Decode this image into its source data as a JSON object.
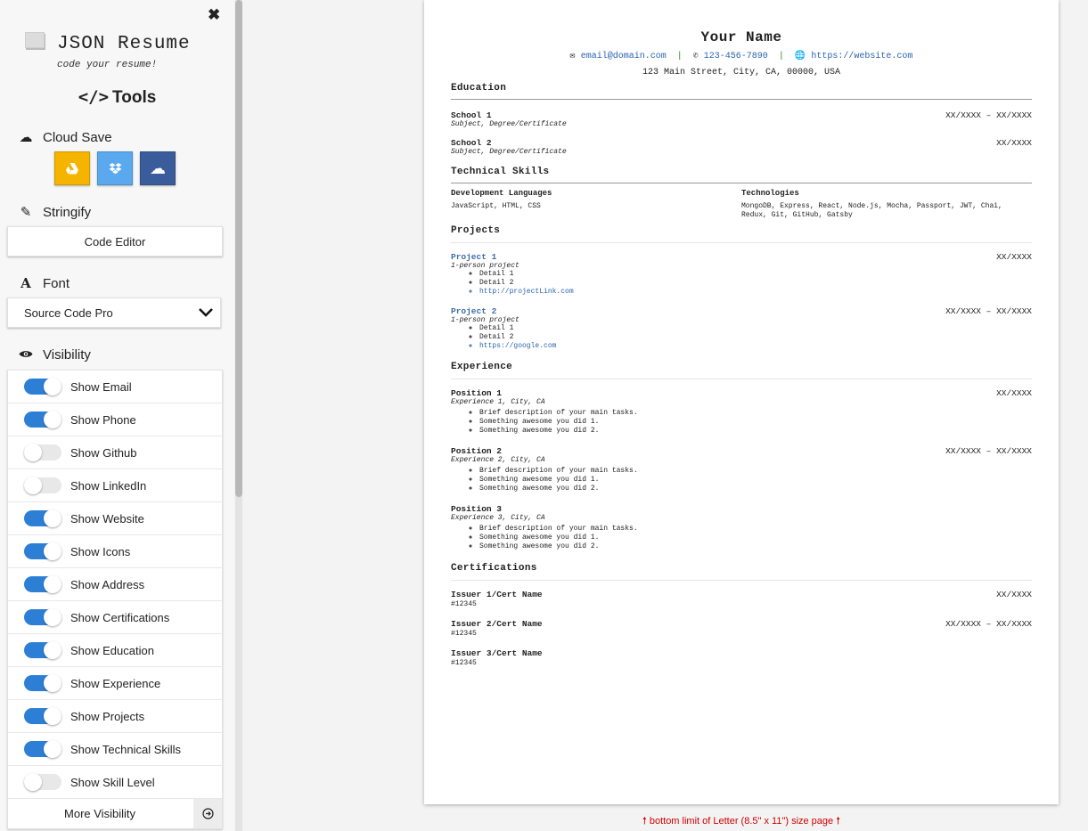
{
  "sidebar": {
    "close_icon": "✖",
    "logo": {
      "title": "JSON Resume",
      "subtitle": "code your resume!"
    },
    "tools_label": "Tools",
    "cloud_save": {
      "label": "Cloud Save",
      "buttons": [
        {
          "name": "google-drive",
          "color": "#f4b400"
        },
        {
          "name": "dropbox",
          "color": "#5aa8ee"
        },
        {
          "name": "cloud",
          "color": "#3a5c9a"
        }
      ]
    },
    "stringify": {
      "label": "Stringify",
      "button": "Code Editor"
    },
    "font": {
      "label": "Font",
      "selected": "Source Code Pro"
    },
    "visibility": {
      "label": "Visibility",
      "toggles": [
        {
          "label": "Show Email",
          "on": true
        },
        {
          "label": "Show Phone",
          "on": true
        },
        {
          "label": "Show Github",
          "on": false
        },
        {
          "label": "Show LinkedIn",
          "on": false
        },
        {
          "label": "Show Website",
          "on": true
        },
        {
          "label": "Show Icons",
          "on": true
        },
        {
          "label": "Show Address",
          "on": true
        },
        {
          "label": "Show Certifications",
          "on": true
        },
        {
          "label": "Show Education",
          "on": true
        },
        {
          "label": "Show Experience",
          "on": true
        },
        {
          "label": "Show Projects",
          "on": true
        },
        {
          "label": "Show Technical Skills",
          "on": true
        },
        {
          "label": "Show Skill Level",
          "on": false
        }
      ],
      "more": "More Visibility"
    }
  },
  "resume": {
    "name": "Your Name",
    "email": "email@domain.com",
    "phone": "123-456-7890",
    "website": "https://website.com",
    "address": "123 Main Street, City, CA, 00000, USA",
    "education": {
      "title": "Education",
      "items": [
        {
          "school": "School 1",
          "degree": "Subject, Degree/Certificate",
          "date": "XX/XXXX – XX/XXXX"
        },
        {
          "school": "School 2",
          "degree": "Subject, Degree/Certificate",
          "date": "XX/XXXX"
        }
      ]
    },
    "skills": {
      "title": "Technical Skills",
      "columns": [
        {
          "heading": "Development Languages",
          "text": "JavaScript, HTML, CSS"
        },
        {
          "heading": "Technologies",
          "text": "MongoDB, Express, React, Node.js, Mocha, Passport, JWT, Chai, Redux, Git, GitHub, Gatsby"
        }
      ]
    },
    "projects": {
      "title": "Projects",
      "items": [
        {
          "name": "Project 1",
          "sub": "1-person project",
          "date": "XX/XXXX",
          "details": [
            "Detail 1",
            "Detail 2"
          ],
          "link": "http://projectLink.com"
        },
        {
          "name": "Project 2",
          "sub": "1-person project",
          "date": "XX/XXXX – XX/XXXX",
          "details": [
            "Detail 1",
            "Detail 2"
          ],
          "link": "https://google.com"
        }
      ]
    },
    "experience": {
      "title": "Experience",
      "items": [
        {
          "position": "Position 1",
          "company": "Experience 1, City, CA",
          "date": "XX/XXXX",
          "bullets": [
            "Brief description of your main tasks.",
            "Something awesome you did 1.",
            "Something awesome you did 2."
          ]
        },
        {
          "position": "Position 2",
          "company": "Experience 2, City, CA",
          "date": "XX/XXXX – XX/XXXX",
          "bullets": [
            "Brief description of your main tasks.",
            "Something awesome you did 1.",
            "Something awesome you did 2."
          ]
        },
        {
          "position": "Position 3",
          "company": "Experience 3, City, CA",
          "date": "",
          "bullets": [
            "Brief description of your main tasks.",
            "Something awesome you did 1.",
            "Something awesome you did 2."
          ]
        }
      ]
    },
    "certifications": {
      "title": "Certifications",
      "items": [
        {
          "name": "Issuer 1/Cert Name",
          "id": "#12345",
          "date": "XX/XXXX"
        },
        {
          "name": "Issuer 2/Cert Name",
          "id": "#12345",
          "date": "XX/XXXX – XX/XXXX"
        },
        {
          "name": "Issuer 3/Cert Name",
          "id": "#12345",
          "date": ""
        }
      ]
    }
  },
  "footer_note": "bottom limit of Letter (8.5\" x 11\") size page"
}
